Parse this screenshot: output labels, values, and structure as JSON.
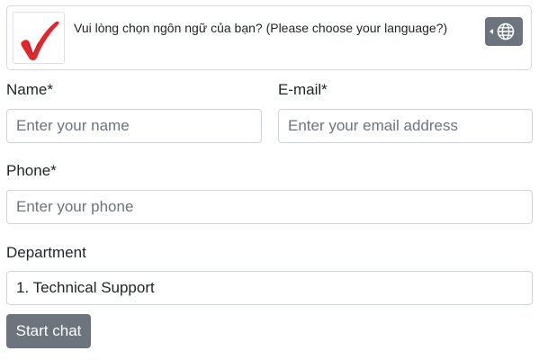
{
  "language_banner": {
    "prompt": "Vui lòng chọn ngôn ngữ của bạn? (Please choose your language?)",
    "logo_icon": "red-checkmark-logo",
    "button_icon": "globe-icon"
  },
  "form": {
    "name": {
      "label": "Name*",
      "placeholder": "Enter your name",
      "value": ""
    },
    "email": {
      "label": "E-mail*",
      "placeholder": "Enter your email address",
      "value": ""
    },
    "phone": {
      "label": "Phone*",
      "placeholder": "Enter your phone",
      "value": ""
    },
    "department": {
      "label": "Department",
      "selected": "1. Technical Support"
    },
    "submit_label": "Start chat"
  },
  "colors": {
    "logo_red": "#e0282c",
    "button_gray": "#6c757d",
    "border": "#ced4da"
  }
}
